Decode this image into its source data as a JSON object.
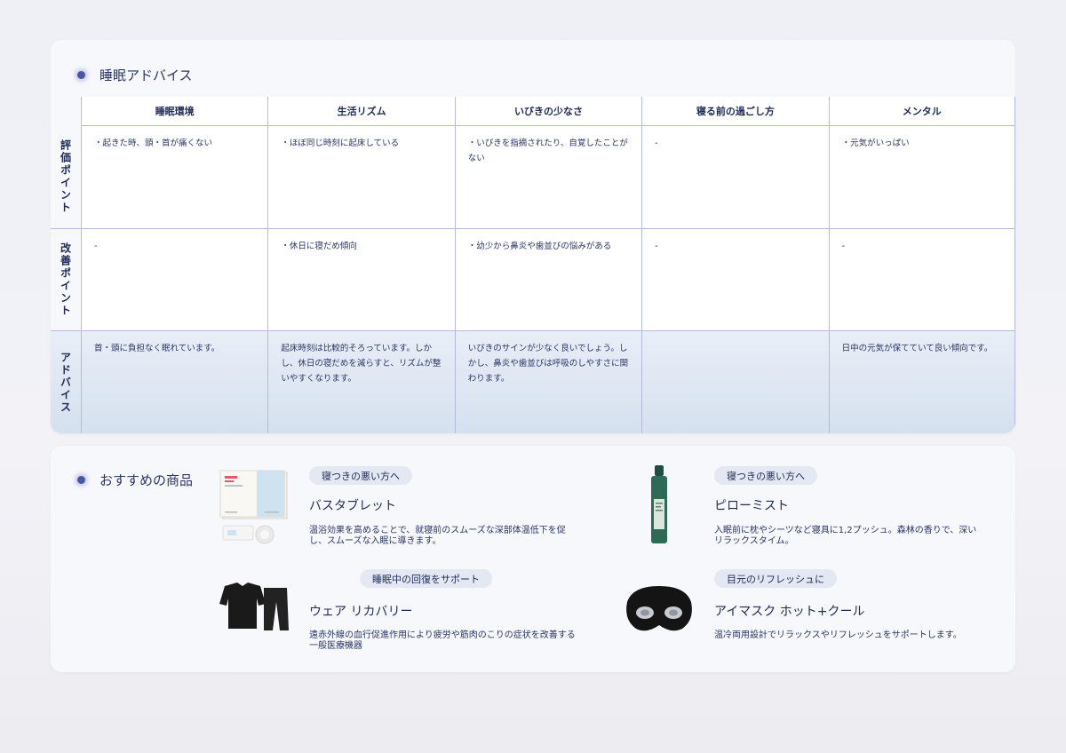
{
  "advice": {
    "title": "睡眠アドバイス",
    "columns": [
      "睡眠環境",
      "生活リズム",
      "いびきの少なさ",
      "寝る前の過ごし方",
      "メンタル"
    ],
    "rows": [
      {
        "label": "評価ポイント",
        "cells": [
          "・起きた時、頭・首が痛くない",
          "・ほぼ同じ時刻に起床している",
          "・いびきを指摘されたり、自覚したことがない",
          "-",
          "・元気がいっぱい"
        ]
      },
      {
        "label": "改善ポイント",
        "cells": [
          "-",
          "・休日に寝だめ傾向",
          "・幼少から鼻炎や歯並びの悩みがある",
          "-",
          "-"
        ]
      },
      {
        "label": "アドバイス",
        "cells": [
          "首・頭に負担なく眠れています。",
          "起床時刻は比較的そろっています。しかし、休日の寝だめを減らすと、リズムが整いやすくなります。",
          "いびきのサインが少なく良いでしょう。しかし、鼻炎や歯並びは呼吸のしやすさに関わります。",
          "",
          "日中の元気が保てていて良い傾向です。"
        ]
      }
    ]
  },
  "products": {
    "title": "おすすめの商品",
    "items": [
      {
        "tag": "寝つきの悪い方へ",
        "name": "バスタブレット",
        "desc": "温浴効果を高めることで、就寝前のスムーズな深部体温低下を促し、スムーズな入眠に導きます。",
        "icon": "bath-tablet-box-image"
      },
      {
        "tag": "寝つきの悪い方へ",
        "name": "ピローミスト",
        "desc": "入眠前に枕やシーツなど寝具に1,2プッシュ。森林の香りで、深いリラックスタイム。",
        "icon": "pillow-mist-bottle-image"
      },
      {
        "tag": "睡眠中の回復をサポート",
        "name": "ウェア リカバリー",
        "desc": "遠赤外線の血行促進作用により疲労や筋肉のこりの症状を改善する一般医療機器",
        "icon": "recovery-wear-image"
      },
      {
        "tag": "目元のリフレッシュに",
        "name": "アイマスク ホット+クール",
        "desc": "温冷両用設計でリラックスやリフレッシュをサポートします。",
        "icon": "eye-mask-image"
      }
    ]
  },
  "colors": {
    "accent": "#4a55a8",
    "text": "#1f2a55",
    "border": "#b5bad8",
    "tag_bg": "#e3e8f2"
  }
}
